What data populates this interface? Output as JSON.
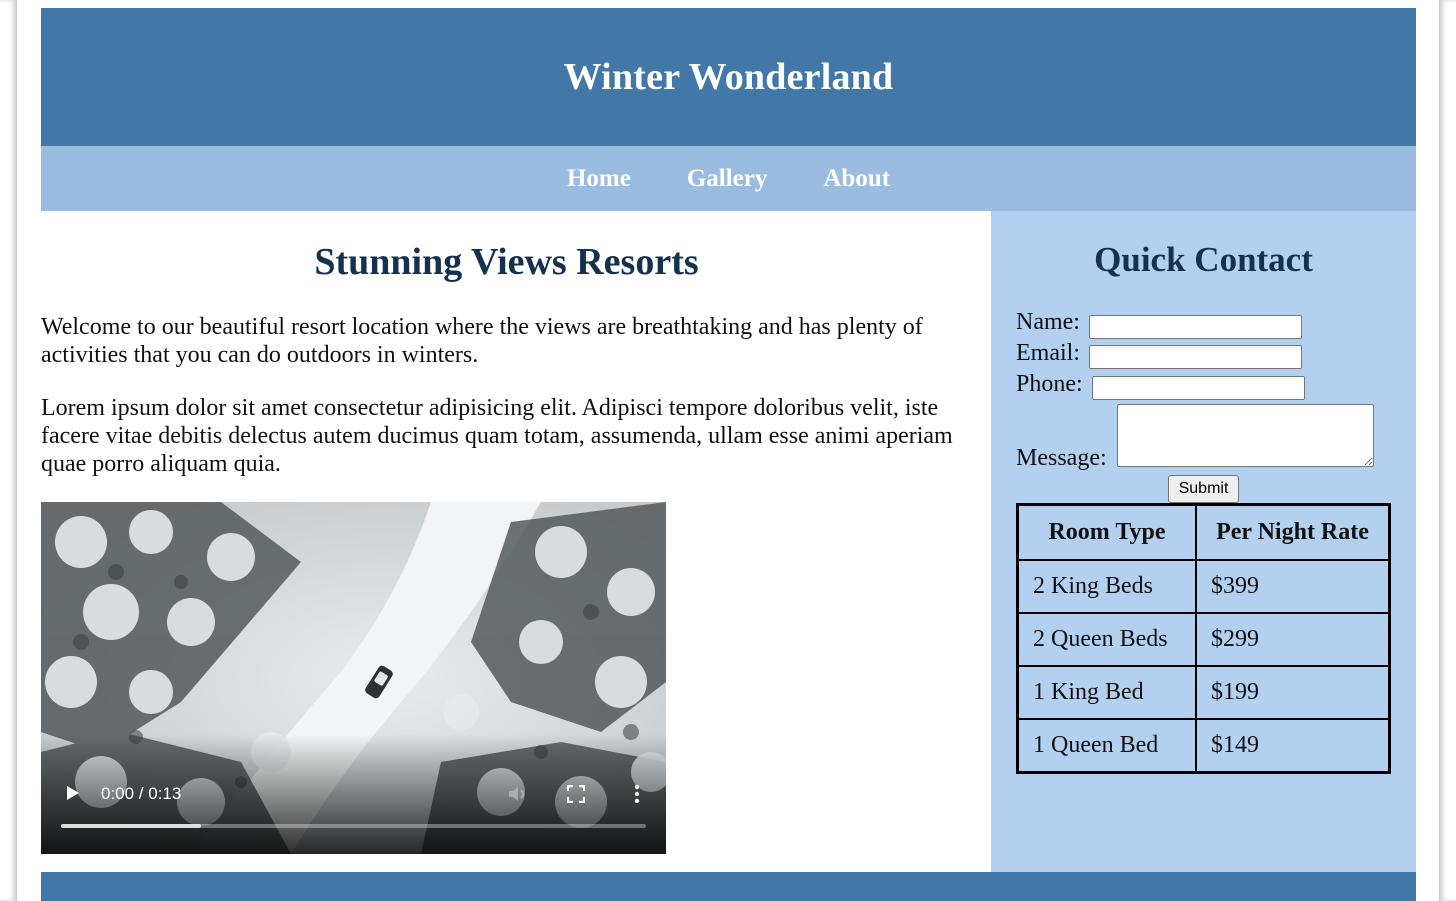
{
  "site": {
    "title": "Winter Wonderland"
  },
  "nav": {
    "items": [
      {
        "label": "Home"
      },
      {
        "label": "Gallery"
      },
      {
        "label": "About"
      }
    ]
  },
  "main": {
    "heading": "Stunning Views Resorts",
    "paragraphs": [
      "Welcome to our beautiful resort location where the views are breathtaking and has plenty of activities that you can do outdoors in winters.",
      "Lorem ipsum dolor sit amet consectetur adipisicing elit. Adipisci tempore doloribus velit, iste facere vitae debitis delectus autem ducimus quam totam, assumenda, ullam esse animi aperiam quae porro aliquam quia."
    ],
    "video": {
      "time": "0:00 / 0:13",
      "buffered_fraction": 0.24
    }
  },
  "contact": {
    "heading": "Quick Contact",
    "fields": {
      "name_label": "Name:",
      "name_value": "",
      "email_label": "Email:",
      "email_value": "",
      "phone_label": "Phone:",
      "phone_value": "",
      "message_label": "Message:",
      "message_value": ""
    },
    "submit_label": "Submit"
  },
  "rates_table": {
    "headers": [
      "Room Type",
      "Per Night Rate"
    ],
    "rows": [
      [
        "2 King Beds",
        "$399"
      ],
      [
        "2 Queen Beds",
        "$299"
      ],
      [
        "1 King Bed",
        "$199"
      ],
      [
        "1 Queen Bed",
        "$149"
      ]
    ]
  },
  "colors": {
    "header_blue": "#4178a7",
    "nav_blue": "#9bbce1",
    "sidebar_blue": "#b3d0f1",
    "heading_navy": "#15314f"
  },
  "icons": [
    "play-icon",
    "volume-icon",
    "fullscreen-icon",
    "more-options-icon"
  ]
}
